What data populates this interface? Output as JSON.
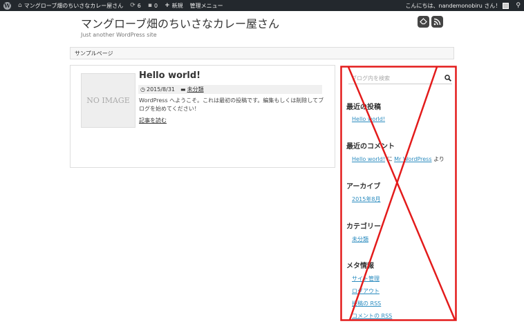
{
  "adminbar": {
    "site_name": "マングローブ畑のちいさなカレー屋さん",
    "updates_count": "6",
    "comments_count": "0",
    "new_label": "新規",
    "admin_menu_label": "管理メニュー",
    "greeting": "こんにちは、nandemonobiru さん！"
  },
  "header": {
    "title": "マングローブ畑のちいさなカレー屋さん",
    "description": "Just another WordPress site"
  },
  "nav": {
    "sample_page": "サンプルページ"
  },
  "post": {
    "thumbnail_text": "NO IMAGE",
    "title": "Hello world!",
    "date": "2015/8/31",
    "category": "未分類",
    "excerpt": "WordPress へようこそ。これは最初の投稿です。編集もしくは削除してブログを始めてください！",
    "read_more": "記事を読む"
  },
  "sidebar": {
    "search_placeholder": "ブログ内を検索",
    "recent_posts_title": "最近の投稿",
    "recent_post_1": "Hello world!",
    "recent_comments_title": "最近のコメント",
    "comment_post": "Hello world!",
    "comment_on": "に",
    "comment_author": "Mr WordPress",
    "comment_suffix": "より",
    "archives_title": "アーカイブ",
    "archive_1": "2015年8月",
    "categories_title": "カテゴリー",
    "category_1": "未分類",
    "meta_title": "メタ情報",
    "meta_admin": "サイト管理",
    "meta_logout": "ログアウト",
    "meta_posts_rss": "投稿の RSS",
    "meta_comments_rss": "コメントの RSS"
  },
  "colors": {
    "adminbar_bg": "#23282d",
    "link": "#2a8bbf",
    "annotation_red": "#e31b1b"
  }
}
